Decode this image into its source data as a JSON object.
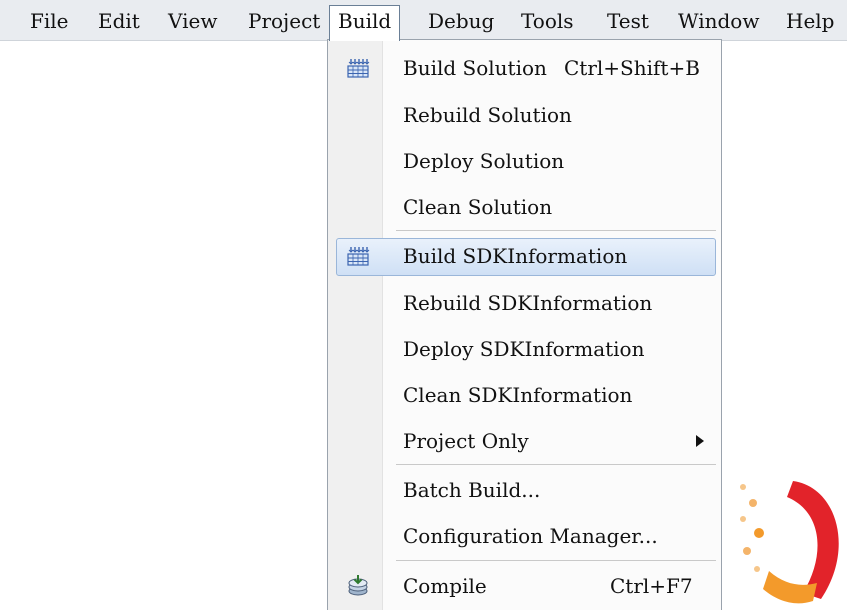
{
  "menubar": {
    "items": [
      {
        "label": "File"
      },
      {
        "label": "Edit"
      },
      {
        "label": "View"
      },
      {
        "label": "Project"
      },
      {
        "label": "Build"
      },
      {
        "label": "Debug"
      },
      {
        "label": "Tools"
      },
      {
        "label": "Test"
      },
      {
        "label": "Window"
      },
      {
        "label": "Help"
      }
    ],
    "active": "Build"
  },
  "build_menu": {
    "items": [
      {
        "label": "Build Solution",
        "shortcut": "Ctrl+Shift+B",
        "icon": "build-icon"
      },
      {
        "label": "Rebuild Solution"
      },
      {
        "label": "Deploy Solution"
      },
      {
        "label": "Clean Solution"
      },
      {
        "label": "Build SDKInformation",
        "icon": "build-icon",
        "highlighted": true
      },
      {
        "label": "Rebuild SDKInformation"
      },
      {
        "label": "Deploy SDKInformation"
      },
      {
        "label": "Clean SDKInformation"
      },
      {
        "label": "Project Only",
        "submenu": true
      },
      {
        "label": "Batch Build..."
      },
      {
        "label": "Configuration Manager..."
      },
      {
        "label": "Compile",
        "shortcut": "Ctrl+F7",
        "icon": "compile-icon"
      }
    ]
  },
  "colors": {
    "menubar_bg": "#e9ecf0",
    "highlight": "#cfe0f5",
    "icon_blue": "#3b64b0",
    "deco_orange": "#f39a2b",
    "deco_red": "#e2232a"
  }
}
